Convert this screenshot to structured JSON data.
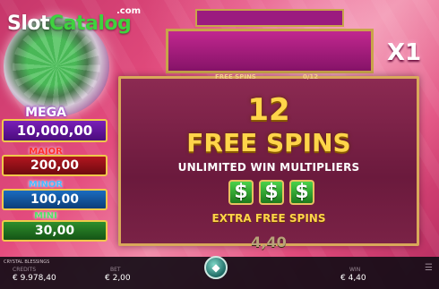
{
  "logo": {
    "slot": "Slot",
    "catalog": "Catalog",
    "com": ".com"
  },
  "jackpots": {
    "mega": {
      "title": "MEGA",
      "value": "10,000,00"
    },
    "major": {
      "title": "MAJOR",
      "value": "200,00"
    },
    "minor": {
      "title": "MINOR",
      "value": "100,00"
    },
    "mini": {
      "title": "MINI",
      "value": "30,00"
    }
  },
  "meter": {
    "multiplier": "X1"
  },
  "free_spins": {
    "label": "FREE SPINS",
    "count": "0/12",
    "awarded": "12",
    "title": "FREE SPINS",
    "subtitle": "UNLIMITED WIN MULTIPLIERS",
    "symbols": [
      "$",
      "$",
      "$"
    ],
    "extra": "EXTRA FREE SPINS",
    "amount": "4,40"
  },
  "bottom_bar": {
    "game_name": "CRYSTAL BLESSINGS",
    "credits_label": "CREDITS",
    "credits_value": "€ 9.978,40",
    "bet_label": "BET",
    "bet_value": "€ 2,00",
    "win_label": "WIN",
    "win_value": "€ 4,40"
  },
  "icons": {
    "spin": "spin-button-icon",
    "menu": "menu-icon"
  },
  "colors": {
    "gold": "#ffd54a",
    "mega": "#7a1fb8",
    "major": "#b3161f",
    "minor": "#1a6cc0",
    "mini": "#2e8e2c"
  }
}
